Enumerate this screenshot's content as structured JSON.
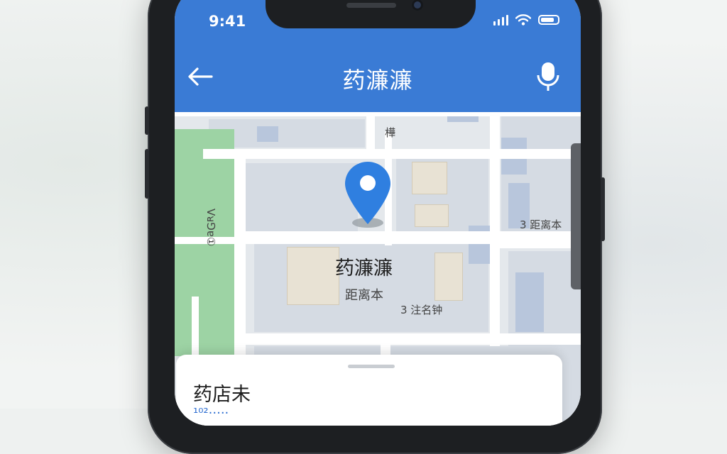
{
  "status_bar": {
    "time": "9:41"
  },
  "app_bar": {
    "title": "药濂濂"
  },
  "map": {
    "place_name": "药濂濂",
    "place_subtitle": "距离本",
    "labels": {
      "north": "樺",
      "west_vertical": "Vᴚ⅁ɐ①",
      "east": "3 距离本",
      "south": "3 注名钟"
    }
  },
  "bottom_sheet": {
    "title": "药店未",
    "subtitle": "¹⁰²·····"
  },
  "colors": {
    "brand": "#3a7bd5",
    "pin": "#2f7fe0",
    "park": "#9dd3a4"
  },
  "icons": [
    "back-arrow-icon",
    "mic-icon",
    "wifi-icon",
    "signal-icon",
    "battery-icon",
    "location-pin-icon"
  ]
}
